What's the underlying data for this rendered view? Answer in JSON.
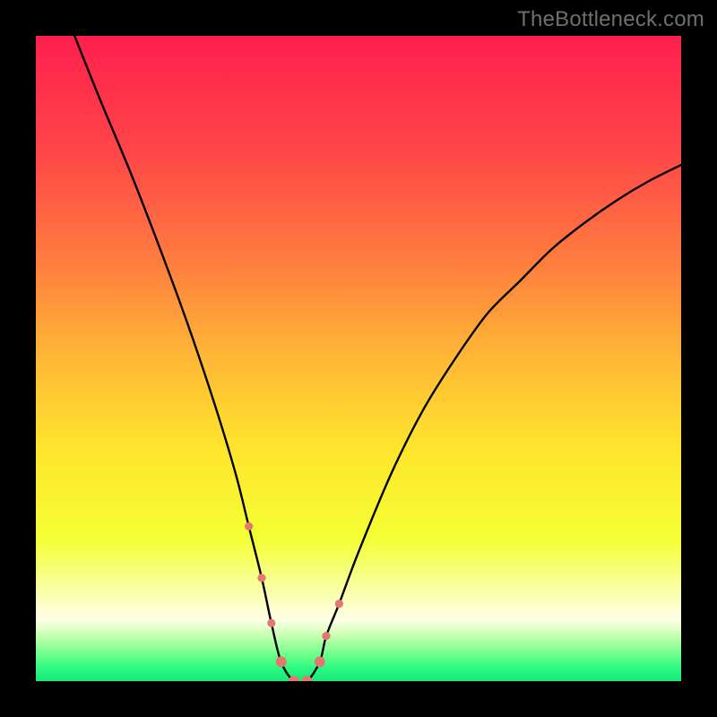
{
  "watermark": "TheBottleneck.com",
  "chart_data": {
    "type": "line",
    "title": "",
    "xlabel": "",
    "ylabel": "",
    "xlim": [
      0,
      100
    ],
    "ylim": [
      0,
      100
    ],
    "grid": false,
    "legend": false,
    "series": [
      {
        "name": "bottleneck-curve",
        "x": [
          6,
          10,
          15,
          20,
          24,
          28,
          31,
          33,
          35,
          36.5,
          38,
          40,
          42,
          44,
          45,
          47,
          50,
          55,
          60,
          65,
          70,
          75,
          80,
          85,
          90,
          95,
          100
        ],
        "values": [
          100,
          90,
          78,
          65,
          54,
          42,
          32,
          24,
          16,
          9,
          3,
          0,
          0,
          3,
          7,
          12,
          20,
          32,
          42,
          50,
          57,
          62,
          67,
          71,
          74.5,
          77.5,
          80
        ]
      }
    ],
    "markers": {
      "name": "highlight-points",
      "color": "#e4776f",
      "x": [
        33,
        35,
        36.5,
        38,
        40,
        42,
        44,
        45,
        47
      ],
      "values": [
        24,
        16,
        9,
        3,
        0,
        0,
        3,
        7,
        12
      ],
      "radius": [
        4.6,
        4.6,
        4.6,
        6.0,
        6.0,
        6.0,
        6.0,
        4.6,
        4.6
      ]
    },
    "gradient_stops": [
      {
        "offset": 0.0,
        "color": "#ff1f4e"
      },
      {
        "offset": 0.18,
        "color": "#ff4648"
      },
      {
        "offset": 0.35,
        "color": "#ff7d3f"
      },
      {
        "offset": 0.5,
        "color": "#ffb836"
      },
      {
        "offset": 0.64,
        "color": "#ffe52d"
      },
      {
        "offset": 0.78,
        "color": "#f4ff34"
      },
      {
        "offset": 0.86,
        "color": "#f9ffa8"
      },
      {
        "offset": 0.905,
        "color": "#ffffe8"
      },
      {
        "offset": 0.93,
        "color": "#c6ffb0"
      },
      {
        "offset": 0.955,
        "color": "#7aff8e"
      },
      {
        "offset": 0.98,
        "color": "#2bfa83"
      },
      {
        "offset": 1.0,
        "color": "#17e87b"
      }
    ]
  }
}
